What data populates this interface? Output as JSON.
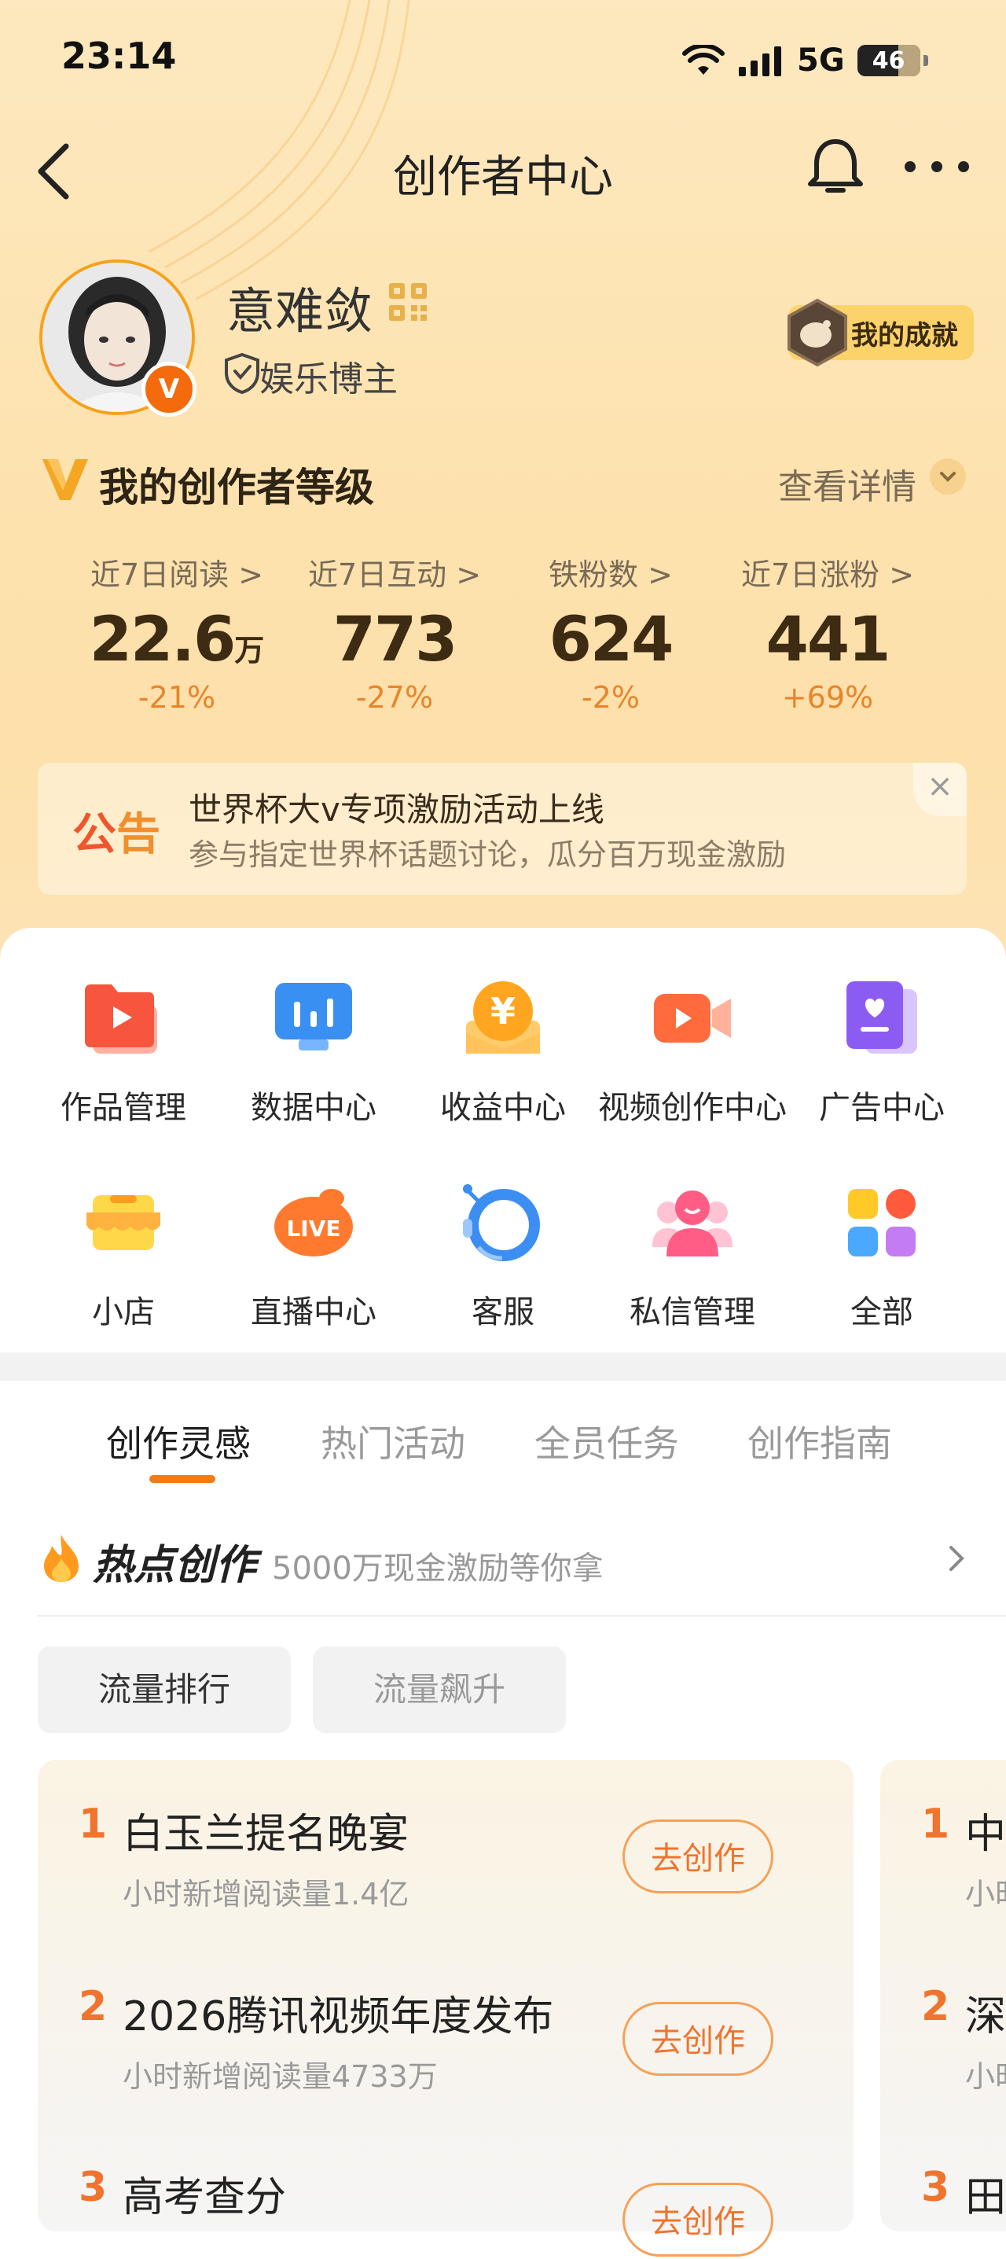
{
  "status_bar": {
    "time": "23:14",
    "network": "5G",
    "battery": "46"
  },
  "header": {
    "title": "创作者中心"
  },
  "profile": {
    "name": "意难敛",
    "verified_badge": "V",
    "tag": "娱乐博主",
    "achievement_label": "我的成就"
  },
  "level": {
    "title": "我的创作者等级",
    "detail_label": "查看详情"
  },
  "stats": [
    {
      "label": "近7日阅读 >",
      "value": "22.6",
      "unit": "万",
      "change": "-21%"
    },
    {
      "label": "近7日互动 >",
      "value": "773",
      "unit": "",
      "change": "-27%"
    },
    {
      "label": "铁粉数 >",
      "value": "624",
      "unit": "",
      "change": "-2%"
    },
    {
      "label": "近7日涨粉 >",
      "value": "441",
      "unit": "",
      "change": "+69%"
    }
  ],
  "notice": {
    "tag_a": "公",
    "tag_b": "告",
    "title": "世界杯大v专项激励活动上线",
    "subtitle": "参与指定世界杯话题讨论，瓜分百万现金激励"
  },
  "tools": [
    {
      "label": "作品管理",
      "icon": "works-folder-icon"
    },
    {
      "label": "数据中心",
      "icon": "data-chart-icon"
    },
    {
      "label": "收益中心",
      "icon": "yuan-coin-icon"
    },
    {
      "label": "视频创作中心",
      "icon": "video-camera-icon"
    },
    {
      "label": "广告中心",
      "icon": "ad-card-icon"
    },
    {
      "label": "小店",
      "icon": "shop-icon"
    },
    {
      "label": "直播中心",
      "icon": "live-icon"
    },
    {
      "label": "客服",
      "icon": "customer-service-icon"
    },
    {
      "label": "私信管理",
      "icon": "messages-people-icon"
    },
    {
      "label": "全部",
      "icon": "all-apps-icon"
    }
  ],
  "tabs": [
    {
      "label": "创作灵感",
      "active": true
    },
    {
      "label": "热门活动",
      "active": false
    },
    {
      "label": "全员任务",
      "active": false
    },
    {
      "label": "创作指南",
      "active": false
    }
  ],
  "hot": {
    "title": "热点创作",
    "subtitle": "5000万现金激励等你拿",
    "filters": [
      "流量排行",
      "流量飙升"
    ]
  },
  "ranking": [
    {
      "rank": "1",
      "title": "白玉兰提名晚宴",
      "sub": "小时新增阅读量1.4亿",
      "action": "去创作"
    },
    {
      "rank": "2",
      "title": "2026腾讯视频年度发布",
      "sub": "小时新增阅读量4733万",
      "action": "去创作"
    },
    {
      "rank": "3",
      "title": "高考查分",
      "sub": "",
      "action": "去创作"
    }
  ],
  "ranking_peek": [
    {
      "rank": "1",
      "title": "中",
      "sub": "小时"
    },
    {
      "rank": "2",
      "title": "深",
      "sub": "小时"
    },
    {
      "rank": "3",
      "title": "田",
      "sub": ""
    }
  ],
  "colors": {
    "accent": "#f67a12",
    "hero_bg": "#fde3b0",
    "rank": "#f0742d"
  }
}
